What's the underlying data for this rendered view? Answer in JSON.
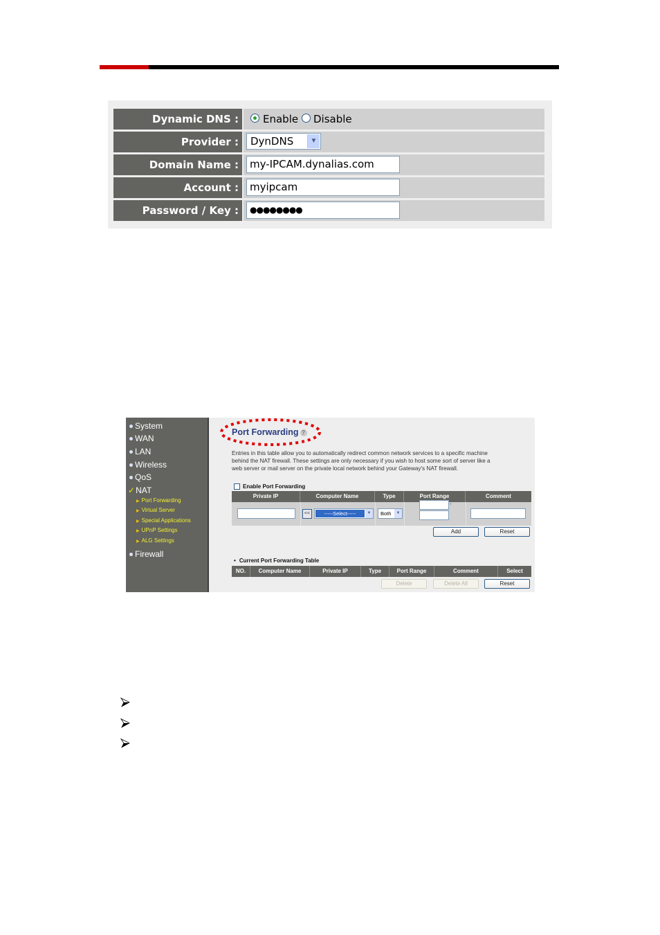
{
  "header": {
    "accent_color": "#cc0000",
    "rule_color": "#000000"
  },
  "ddns_form": {
    "rows": [
      {
        "label": "Dynamic DNS :",
        "type": "radio",
        "options": [
          {
            "label": "Enable",
            "selected": true
          },
          {
            "label": "Disable",
            "selected": false
          }
        ]
      },
      {
        "label": "Provider :",
        "type": "select",
        "value": "DynDNS"
      },
      {
        "label": "Domain Name :",
        "type": "text",
        "value": "my-IPCAM.dynalias.com"
      },
      {
        "label": "Account :",
        "type": "text",
        "value": "myipcam"
      },
      {
        "label": "Password / Key :",
        "type": "password",
        "value": "●●●●●●●●"
      }
    ]
  },
  "router_ui": {
    "sidebar": {
      "items": [
        {
          "label": "System",
          "icon": "dot-icon"
        },
        {
          "label": "WAN",
          "icon": "dot-icon"
        },
        {
          "label": "LAN",
          "icon": "dot-icon"
        },
        {
          "label": "Wireless",
          "icon": "dot-icon"
        },
        {
          "label": "QoS",
          "icon": "dot-icon"
        },
        {
          "label": "NAT",
          "icon": "check-icon",
          "active": true
        },
        {
          "label": "Firewall",
          "icon": "dot-icon"
        }
      ],
      "nat_subitems": [
        "Port Forwarding",
        "Virtual Server",
        "Special Applications",
        "UPnP Settings",
        "ALG Settings"
      ],
      "check_glyph": "✓",
      "sub_glyph": "▶"
    },
    "page_title": "Port Forwarding",
    "help_glyph": "?",
    "description_lines": [
      "Entries in this table allow you to automatically redirect common network services to a specific machine",
      "behind the NAT firewall. These settings are only necessary if you wish to host some sort of server like a",
      "web server or mail server on the private local network behind your Gateway's NAT firewall."
    ],
    "enable_checkbox_label": "Enable Port Forwarding",
    "enable_checked": false,
    "entry_table": {
      "headers": [
        "Private IP",
        "Computer Name",
        "Type",
        "Port Range",
        "Comment"
      ],
      "copy_button": "<<",
      "computer_select": "-----Select-----",
      "type_select": "Both",
      "port_range_separator": "-",
      "add_button": "Add",
      "reset_button": "Reset"
    },
    "current_table": {
      "title": "Current Port Forwarding Table",
      "bullet": "•",
      "headers": [
        "NO.",
        "Computer Name",
        "Private IP",
        "Type",
        "Port Range",
        "Comment",
        "Select"
      ],
      "delete_button": "Delete",
      "delete_all_button": "Delete All",
      "reset_button": "Reset"
    },
    "highlight_color": "#e00000"
  },
  "bullet_list": {
    "glyph": "arrowhead-icon",
    "count": 3
  }
}
